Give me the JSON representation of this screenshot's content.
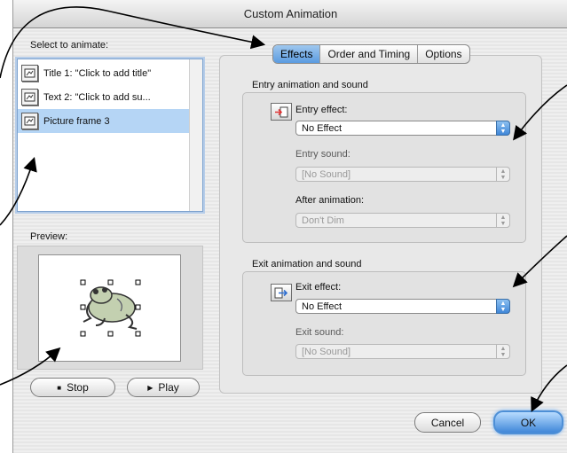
{
  "window": {
    "title": "Custom Animation"
  },
  "left": {
    "select_label": "Select to animate:",
    "items": [
      {
        "label": "Title 1: \"Click to add title\""
      },
      {
        "label": "Text 2: \"Click to add su..."
      },
      {
        "label": "Picture frame 3"
      }
    ],
    "selected_item": "Picture frame 3",
    "preview_label": "Preview:",
    "stop_label": "Stop",
    "play_label": "Play"
  },
  "tabs": [
    {
      "label": "Effects"
    },
    {
      "label": "Order and Timing"
    },
    {
      "label": "Options"
    }
  ],
  "active_tab": "Effects",
  "entry": {
    "group_title": "Entry animation and sound",
    "effect_label": "Entry effect:",
    "effect_value": "No Effect",
    "sound_label": "Entry sound:",
    "sound_value": "[No Sound]",
    "after_label": "After animation:",
    "after_value": "Don't Dim"
  },
  "exit": {
    "group_title": "Exit animation and sound",
    "effect_label": "Exit effect:",
    "effect_value": "No Effect",
    "sound_label": "Exit sound:",
    "sound_value": "[No Sound]"
  },
  "buttons": {
    "cancel": "Cancel",
    "ok": "OK"
  },
  "colors": {
    "accent": "#3f86d8",
    "selection": "#b5d5f5"
  }
}
